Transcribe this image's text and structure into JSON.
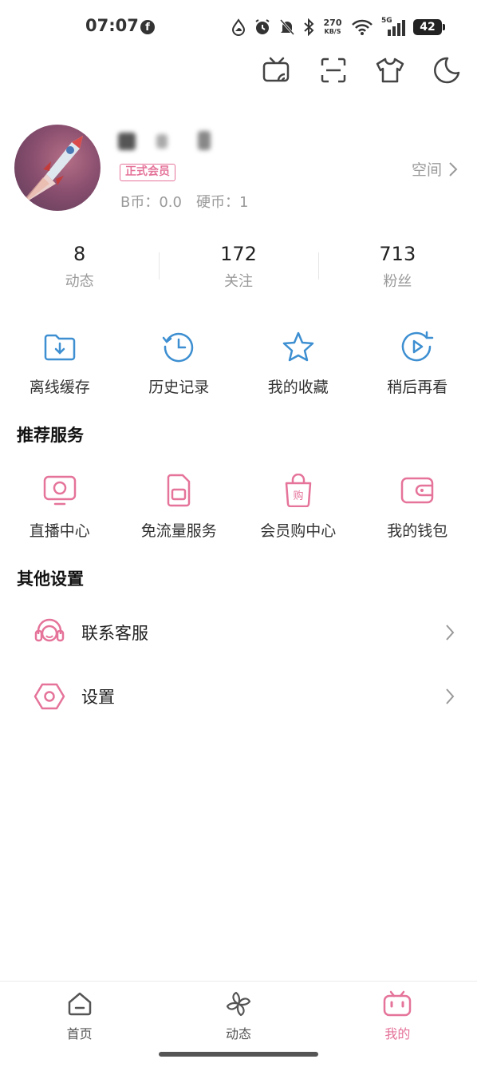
{
  "status_bar": {
    "time": "07:07",
    "facebook_icon": "facebook-icon",
    "net_speed_value": "270",
    "net_speed_unit": "KB/S",
    "network_type": "5G",
    "battery": "42"
  },
  "top_actions": [
    "tv-cast-icon",
    "scan-icon",
    "theme-shirt-icon",
    "night-mode-moon-icon"
  ],
  "profile": {
    "vip_badge": "正式会员",
    "b_coin": "B币：0.0",
    "hard_coin": "硬币：1",
    "space_link": "空间"
  },
  "stats": [
    {
      "num": "8",
      "label": "动态"
    },
    {
      "num": "172",
      "label": "关注"
    },
    {
      "num": "713",
      "label": "粉丝"
    }
  ],
  "quick_actions": [
    {
      "label": "离线缓存",
      "icon": "download-folder-icon"
    },
    {
      "label": "历史记录",
      "icon": "history-clock-icon"
    },
    {
      "label": "我的收藏",
      "icon": "star-icon"
    },
    {
      "label": "稍后再看",
      "icon": "watch-later-icon"
    }
  ],
  "recommended_title": "推荐服务",
  "recommended": [
    {
      "label": "直播中心",
      "icon": "live-tv-icon"
    },
    {
      "label": "免流量服务",
      "icon": "sim-card-icon"
    },
    {
      "label": "会员购中心",
      "icon": "shopping-bag-icon"
    },
    {
      "label": "我的钱包",
      "icon": "wallet-icon"
    }
  ],
  "other_title": "其他设置",
  "other": [
    {
      "label": "联系客服",
      "icon": "headset-icon"
    },
    {
      "label": "设置",
      "icon": "settings-hexagon-icon"
    }
  ],
  "bottom_nav": [
    {
      "label": "首页",
      "icon": "home-icon"
    },
    {
      "label": "动态",
      "icon": "pinwheel-icon"
    },
    {
      "label": "我的",
      "icon": "bilibili-tv-icon",
      "active": true
    }
  ],
  "colors": {
    "accent_pink": "#e5739a",
    "accent_blue": "#3d8fd1",
    "secondary_text": "#9a9a9a"
  }
}
